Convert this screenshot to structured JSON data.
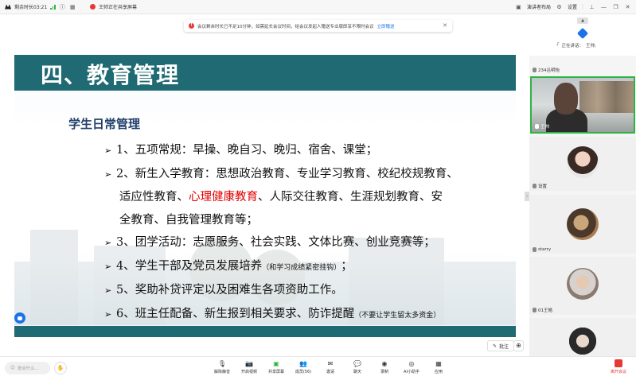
{
  "topbar": {
    "timer_label": "剩余时长03:21",
    "share_status": "王帅正在共享屏幕",
    "layout_label": "演讲者布局",
    "settings_label": "设置"
  },
  "notice": {
    "text": "会议剩余时长已不足10分钟，如需延长会议时间，给会议发起人赠送专业版即享不限时会议",
    "link": "立即赠送"
  },
  "slide": {
    "title": "四、教育管理",
    "section": "学生日常管理",
    "bullet1": "1、五项常规：早操、晚自习、晚归、宿舍、课堂；",
    "bullet2_a": "2、新生入学教育：思想政治教育、专业学习教育、校纪校规教育、",
    "bullet2_b1": "适应性教育、",
    "bullet2_b_red": "心理健康教育",
    "bullet2_b2": "、人际交往教育、生涯规划教育、安",
    "bullet2_c": "全教育、自我管理教育等；",
    "bullet3": "3、团学活动：志愿服务、社会实践、文体比赛、创业竞赛等；",
    "bullet4": "4、学生干部及党员发展培养",
    "bullet4_note": "（和学习成绩紧密挂钩）",
    "bullet4_end": "；",
    "bullet5": "5、奖助补贷评定以及困难生各项资助工作。",
    "bullet6": "6、班主任配备、新生报到相关要求、防诈提醒",
    "bullet6_note": "（不要让学生留太多资金）"
  },
  "annotate_label": "批注",
  "panel": {
    "speaking_label": "正在讲话：",
    "speaking_name": "王帅;",
    "participants": [
      {
        "name": "234吕明怡"
      },
      {
        "name": "王帅"
      },
      {
        "name": "设置"
      },
      {
        "name": "starry"
      },
      {
        "name": "01王皓"
      },
      {
        "name": "李昭成"
      }
    ]
  },
  "toolbar": {
    "chat_placeholder": "说点什么...",
    "tools": [
      "解除静音",
      "开启视频",
      "共享屏幕",
      "成员(56)",
      "邀请",
      "聊天",
      "录制",
      "AI小助手",
      "应用"
    ],
    "leave": "离开会议"
  },
  "colors": {
    "slide_teal": "#1f6a73",
    "accent_red": "#e00000",
    "speaking_green": "#2fb344",
    "brand_blue": "#1a73e8"
  }
}
